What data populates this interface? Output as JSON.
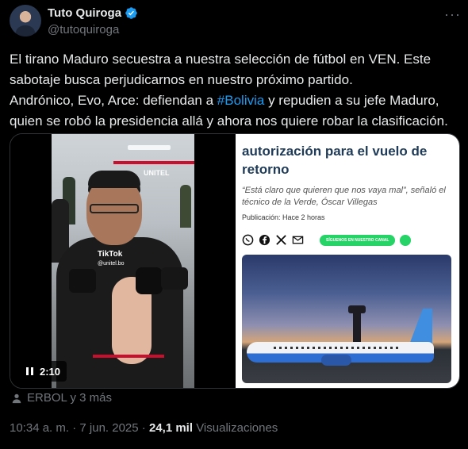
{
  "author": {
    "name": "Tuto Quiroga",
    "handle": "@tutoquiroga",
    "verified": true
  },
  "tweet": {
    "line1": "El tirano Maduro secuestra a nuestra selección de fútbol en VEN. Este sabotaje busca perjudicarnos en nuestro próximo partido.",
    "line2_before": "Andrónico, Evo, Arce: defiendan a ",
    "hashtag": "#Bolivia",
    "line2_after": " y repudien a su jefe Maduro, quien se robó la presidencia allá y ahora nos quiere robar la clasificación."
  },
  "video": {
    "time": "2:10",
    "brand": "UNITEL",
    "tiktok": "TikTok",
    "tiktok_user": "@unitel.bo",
    "progress": 0.5
  },
  "article": {
    "title": "autorización para el vuelo de retorno",
    "subtitle": "“Está claro que quieren que nos vaya mal”, señaló el técnico de la Verde, Óscar Villegas",
    "date": "Publicación: Hace 2 horas",
    "follow": "SÍGUENOS EN NUESTRO CANAL"
  },
  "tagged": "ERBOL y 3 más",
  "meta": {
    "time": "10:34 a. m.",
    "date": "7 jun. 2025",
    "views": "24,1 mil",
    "views_label": "Visualizaciones"
  },
  "colors": {
    "background": "#000000",
    "text": "#e7e9ea",
    "secondary": "#71767b",
    "link": "#1d9bf0"
  }
}
